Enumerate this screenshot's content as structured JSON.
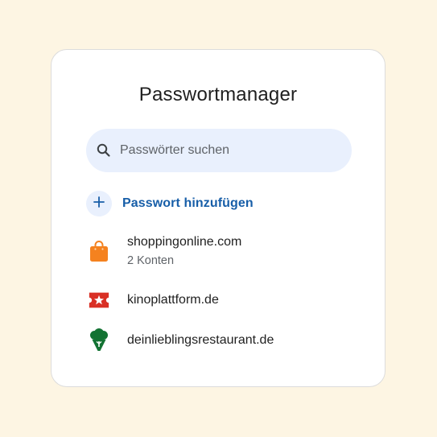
{
  "title": "Passwortmanager",
  "search": {
    "placeholder": "Passwörter suchen",
    "icon": "search-icon"
  },
  "add": {
    "label": "Passwort hinzufügen",
    "icon": "plus-icon"
  },
  "entries": [
    {
      "domain": "shoppingonline.com",
      "sub": "2 Konten",
      "icon": "shopping-bag-icon",
      "color": "#f5821f"
    },
    {
      "domain": "kinoplattform.de",
      "sub": "",
      "icon": "ticket-icon",
      "color": "#d93025"
    },
    {
      "domain": "deinlieblingsrestaurant.de",
      "sub": "",
      "icon": "broccoli-icon",
      "color": "#137333"
    }
  ],
  "colors": {
    "background": "#fdf5e3",
    "accent": "#175ea8",
    "search_bg": "#e9f0fd"
  }
}
